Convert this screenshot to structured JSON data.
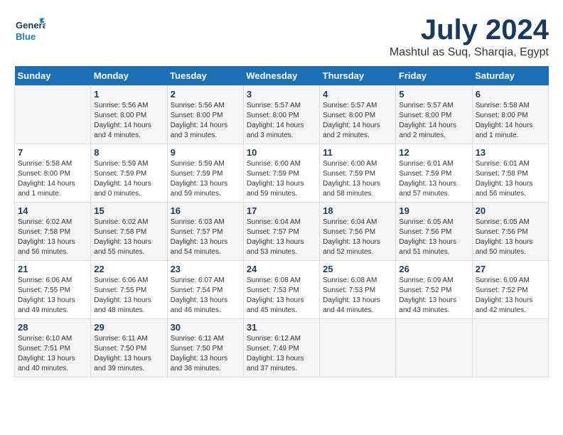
{
  "logo": {
    "line1": "General",
    "line2": "Blue"
  },
  "title": "July 2024",
  "location": "Mashtul as Suq, Sharqia, Egypt",
  "days_of_week": [
    "Sunday",
    "Monday",
    "Tuesday",
    "Wednesday",
    "Thursday",
    "Friday",
    "Saturday"
  ],
  "weeks": [
    [
      {
        "day": "",
        "info": ""
      },
      {
        "day": "1",
        "info": "Sunrise: 5:56 AM\nSunset: 8:00 PM\nDaylight: 14 hours\nand 4 minutes."
      },
      {
        "day": "2",
        "info": "Sunrise: 5:56 AM\nSunset: 8:00 PM\nDaylight: 14 hours\nand 3 minutes."
      },
      {
        "day": "3",
        "info": "Sunrise: 5:57 AM\nSunset: 8:00 PM\nDaylight: 14 hours\nand 3 minutes."
      },
      {
        "day": "4",
        "info": "Sunrise: 5:57 AM\nSunset: 8:00 PM\nDaylight: 14 hours\nand 2 minutes."
      },
      {
        "day": "5",
        "info": "Sunrise: 5:57 AM\nSunset: 8:00 PM\nDaylight: 14 hours\nand 2 minutes."
      },
      {
        "day": "6",
        "info": "Sunrise: 5:58 AM\nSunset: 8:00 PM\nDaylight: 14 hours\nand 1 minute."
      }
    ],
    [
      {
        "day": "7",
        "info": "Sunrise: 5:58 AM\nSunset: 8:00 PM\nDaylight: 14 hours\nand 1 minute."
      },
      {
        "day": "8",
        "info": "Sunrise: 5:59 AM\nSunset: 7:59 PM\nDaylight: 14 hours\nand 0 minutes."
      },
      {
        "day": "9",
        "info": "Sunrise: 5:59 AM\nSunset: 7:59 PM\nDaylight: 13 hours\nand 59 minutes."
      },
      {
        "day": "10",
        "info": "Sunrise: 6:00 AM\nSunset: 7:59 PM\nDaylight: 13 hours\nand 59 minutes."
      },
      {
        "day": "11",
        "info": "Sunrise: 6:00 AM\nSunset: 7:59 PM\nDaylight: 13 hours\nand 58 minutes."
      },
      {
        "day": "12",
        "info": "Sunrise: 6:01 AM\nSunset: 7:59 PM\nDaylight: 13 hours\nand 57 minutes."
      },
      {
        "day": "13",
        "info": "Sunrise: 6:01 AM\nSunset: 7:58 PM\nDaylight: 13 hours\nand 56 minutes."
      }
    ],
    [
      {
        "day": "14",
        "info": "Sunrise: 6:02 AM\nSunset: 7:58 PM\nDaylight: 13 hours\nand 56 minutes."
      },
      {
        "day": "15",
        "info": "Sunrise: 6:02 AM\nSunset: 7:58 PM\nDaylight: 13 hours\nand 55 minutes."
      },
      {
        "day": "16",
        "info": "Sunrise: 6:03 AM\nSunset: 7:57 PM\nDaylight: 13 hours\nand 54 minutes."
      },
      {
        "day": "17",
        "info": "Sunrise: 6:04 AM\nSunset: 7:57 PM\nDaylight: 13 hours\nand 53 minutes."
      },
      {
        "day": "18",
        "info": "Sunrise: 6:04 AM\nSunset: 7:56 PM\nDaylight: 13 hours\nand 52 minutes."
      },
      {
        "day": "19",
        "info": "Sunrise: 6:05 AM\nSunset: 7:56 PM\nDaylight: 13 hours\nand 51 minutes."
      },
      {
        "day": "20",
        "info": "Sunrise: 6:05 AM\nSunset: 7:56 PM\nDaylight: 13 hours\nand 50 minutes."
      }
    ],
    [
      {
        "day": "21",
        "info": "Sunrise: 6:06 AM\nSunset: 7:55 PM\nDaylight: 13 hours\nand 49 minutes."
      },
      {
        "day": "22",
        "info": "Sunrise: 6:06 AM\nSunset: 7:55 PM\nDaylight: 13 hours\nand 48 minutes."
      },
      {
        "day": "23",
        "info": "Sunrise: 6:07 AM\nSunset: 7:54 PM\nDaylight: 13 hours\nand 46 minutes."
      },
      {
        "day": "24",
        "info": "Sunrise: 6:08 AM\nSunset: 7:53 PM\nDaylight: 13 hours\nand 45 minutes."
      },
      {
        "day": "25",
        "info": "Sunrise: 6:08 AM\nSunset: 7:53 PM\nDaylight: 13 hours\nand 44 minutes."
      },
      {
        "day": "26",
        "info": "Sunrise: 6:09 AM\nSunset: 7:52 PM\nDaylight: 13 hours\nand 43 minutes."
      },
      {
        "day": "27",
        "info": "Sunrise: 6:09 AM\nSunset: 7:52 PM\nDaylight: 13 hours\nand 42 minutes."
      }
    ],
    [
      {
        "day": "28",
        "info": "Sunrise: 6:10 AM\nSunset: 7:51 PM\nDaylight: 13 hours\nand 40 minutes."
      },
      {
        "day": "29",
        "info": "Sunrise: 6:11 AM\nSunset: 7:50 PM\nDaylight: 13 hours\nand 39 minutes."
      },
      {
        "day": "30",
        "info": "Sunrise: 6:11 AM\nSunset: 7:50 PM\nDaylight: 13 hours\nand 38 minutes."
      },
      {
        "day": "31",
        "info": "Sunrise: 6:12 AM\nSunset: 7:49 PM\nDaylight: 13 hours\nand 37 minutes."
      },
      {
        "day": "",
        "info": ""
      },
      {
        "day": "",
        "info": ""
      },
      {
        "day": "",
        "info": ""
      }
    ]
  ]
}
